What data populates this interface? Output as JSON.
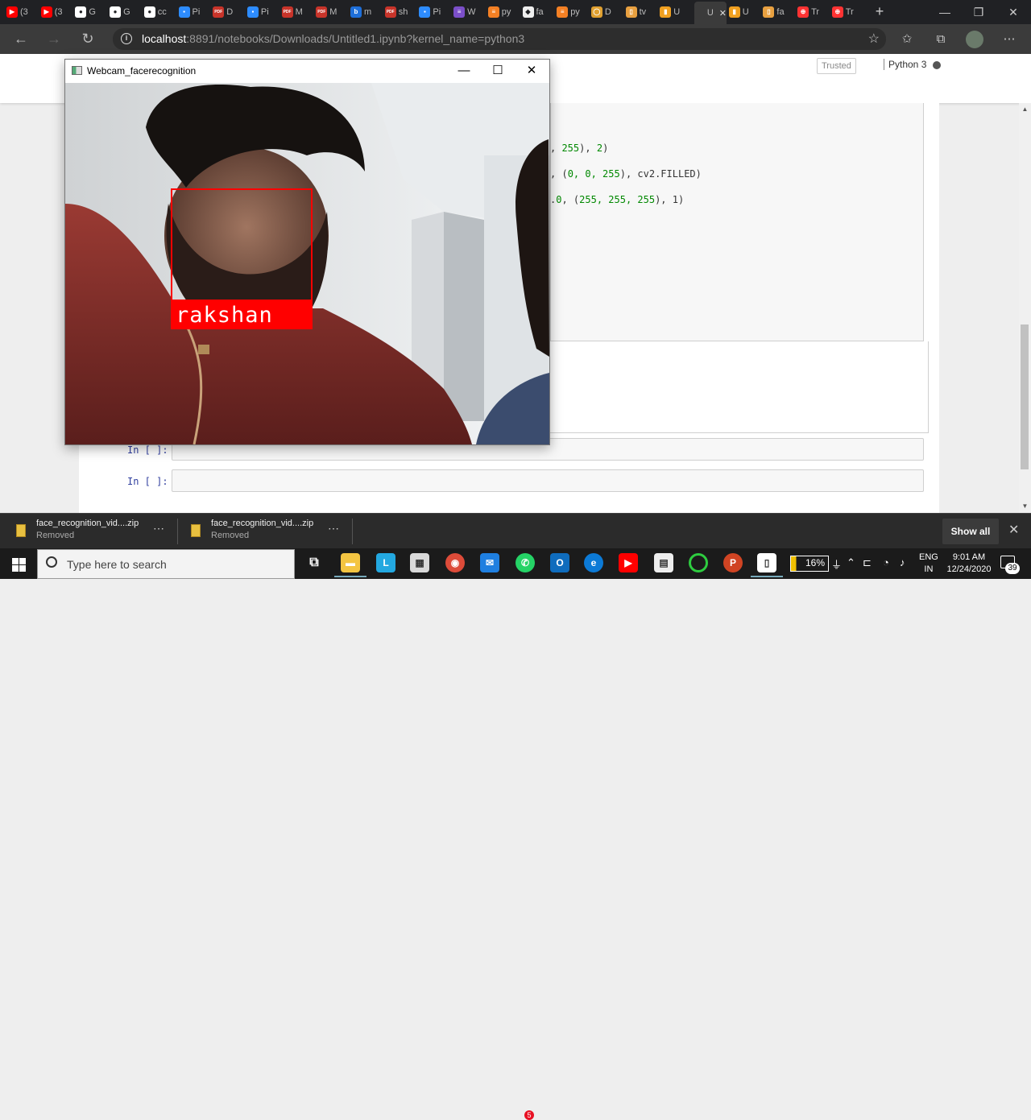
{
  "browser": {
    "tabs": [
      {
        "label": "(3",
        "icon": "youtube-icon",
        "color": "#ff0000",
        "glyph": "▶"
      },
      {
        "label": "(3",
        "icon": "youtube-icon",
        "color": "#ff0000",
        "glyph": "▶"
      },
      {
        "label": "G",
        "icon": "github-icon",
        "color": "#ffffff",
        "glyph": "●"
      },
      {
        "label": "G",
        "icon": "github-icon",
        "color": "#ffffff",
        "glyph": "●"
      },
      {
        "label": "cc",
        "icon": "github-icon",
        "color": "#ffffff",
        "glyph": "●"
      },
      {
        "label": "Pi",
        "icon": "zoom-icon",
        "color": "#2d8cff",
        "glyph": "▪"
      },
      {
        "label": "D",
        "icon": "pdf-icon",
        "color": "#c8342a",
        "glyph": "PDF"
      },
      {
        "label": "Pi",
        "icon": "zoom-icon",
        "color": "#2d8cff",
        "glyph": "▪"
      },
      {
        "label": "M",
        "icon": "pdf-icon",
        "color": "#c8342a",
        "glyph": "PDF"
      },
      {
        "label": "M",
        "icon": "pdf-icon",
        "color": "#c8342a",
        "glyph": "PDF"
      },
      {
        "label": "m",
        "icon": "bing-icon",
        "color": "#1e6fd9",
        "glyph": "b"
      },
      {
        "label": "sh",
        "icon": "pdf-icon",
        "color": "#c8342a",
        "glyph": "PDF"
      },
      {
        "label": "Pi",
        "icon": "zoom-icon",
        "color": "#2d8cff",
        "glyph": "▪"
      },
      {
        "label": "W",
        "icon": "forms-icon",
        "color": "#7b4fc9",
        "glyph": "≡"
      },
      {
        "label": "py",
        "icon": "stackoverflow-icon",
        "color": "#f48024",
        "glyph": "≡"
      },
      {
        "label": "fa",
        "icon": "cube-icon",
        "color": "#eeeeee",
        "glyph": "◆"
      },
      {
        "label": "py",
        "icon": "stackoverflow-icon",
        "color": "#f48024",
        "glyph": "≡"
      },
      {
        "label": "D",
        "icon": "spinner-icon",
        "color": "#e0a030",
        "glyph": "◯"
      },
      {
        "label": "tv",
        "icon": "document-icon",
        "color": "#e8a040",
        "glyph": "▯"
      },
      {
        "label": "U",
        "icon": "book-icon",
        "color": "#f0a020",
        "glyph": "▮"
      },
      {
        "label": "U",
        "icon": "page-icon",
        "color": "#3b3b3b",
        "glyph": ""
      },
      {
        "label": "U",
        "icon": "book-icon",
        "color": "#f0a020",
        "glyph": "▮"
      },
      {
        "label": "fa",
        "icon": "document-icon",
        "color": "#e8a040",
        "glyph": "▯"
      },
      {
        "label": "Tr",
        "icon": "globe-icon",
        "color": "#ff3333",
        "glyph": "⊕"
      },
      {
        "label": "Tr",
        "icon": "globe-icon",
        "color": "#ff3333",
        "glyph": "⊕"
      }
    ],
    "active_tab_close": "✕",
    "new_tab": "+",
    "window_controls": {
      "minimize": "—",
      "maximize": "❐",
      "close": "✕"
    },
    "url_host": "localhost",
    "url_rest": ":8891/notebooks/Downloads/Untitled1.ipynb?kernel_name=python3"
  },
  "notebook": {
    "trusted": "Trusted",
    "kernel": "Python 3",
    "code_lines": [
      {
        "pre": ", ",
        "n1": "255",
        "mid": "), ",
        "n2": "2",
        "post": ")"
      },
      {
        "pre": ", (",
        "n1": "0, 0, 255",
        "mid": "), cv2.FILLED)",
        "n2": "",
        "post": ""
      },
      {
        "pre": ".",
        "n1": "0",
        "mid": ", (",
        "n2": "255, 255, 255",
        "post": "), 1)"
      }
    ],
    "in_prompt_1": "In [ ]:",
    "in_prompt_2": "In [ ]:"
  },
  "webcam_window": {
    "title": "Webcam_facerecognition",
    "detected_name": "rakshan",
    "box_color": "#ff0000"
  },
  "downloads": {
    "items": [
      {
        "name": "face_recognition_vid....zip",
        "status": "Removed"
      },
      {
        "name": "face_recognition_vid....zip",
        "status": "Removed"
      }
    ],
    "show_all": "Show all"
  },
  "taskbar": {
    "search_placeholder": "Type here to search",
    "battery": "16%",
    "lang_line1": "ENG",
    "lang_line2": "IN",
    "time": "9:01 AM",
    "date": "12/24/2020",
    "notifications": "39",
    "whatsapp_badge": "5"
  }
}
